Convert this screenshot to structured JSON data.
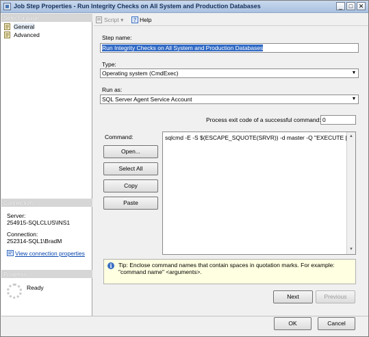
{
  "window": {
    "title": "Job Step Properties - Run Integrity Checks on All System and Production Databases",
    "controls": {
      "minimize": "_",
      "maximize": "□",
      "close": "✕"
    }
  },
  "sidebar": {
    "select_page_header": "Select a page",
    "pages": [
      {
        "label": "General",
        "icon": "page-icon",
        "selected": true
      },
      {
        "label": "Advanced",
        "icon": "page-icon",
        "selected": false
      }
    ],
    "connection_header": "Connection",
    "server_label": "Server:",
    "server_value": "254915-SQLCLUS\\INS1",
    "connection_label": "Connection:",
    "connection_value": "252314-SQL1\\BradM",
    "view_connection_link": "View connection properties",
    "progress_header": "Progress",
    "progress_status": "Ready"
  },
  "toolbar": {
    "script_label": "Script",
    "script_dropdown": "▾",
    "help_label": "Help"
  },
  "form": {
    "step_name_label": "Step name:",
    "step_name_value": "Run Integrity Checks on All System and Production Databases",
    "type_label": "Type:",
    "type_value": "Operating system (CmdExec)",
    "run_as_label": "Run as:",
    "run_as_value": "SQL Server Agent Service Account",
    "exit_code_label": "Process exit code of a successful command:",
    "exit_code_value": "0",
    "command_label": "Command:",
    "command_value": "sqlcmd -E -S $(ESCAPE_SQUOTE(SRVR)) -d master -Q \"EXECUTE [dbo",
    "open_button": "Open...",
    "select_all_button": "Select All",
    "copy_button": "Copy",
    "paste_button": "Paste",
    "tip_text": "Tip: Enclose command names that contain spaces in quotation marks. For example: \"command name\" <arguments>.",
    "next_button": "Next",
    "previous_button": "Previous"
  },
  "footer": {
    "ok_button": "OK",
    "cancel_button": "Cancel"
  },
  "colors": {
    "title_bar": "#a9c1e0",
    "selection": "#316ac5",
    "tip_background": "#ffffe1",
    "link": "#0645ad"
  }
}
